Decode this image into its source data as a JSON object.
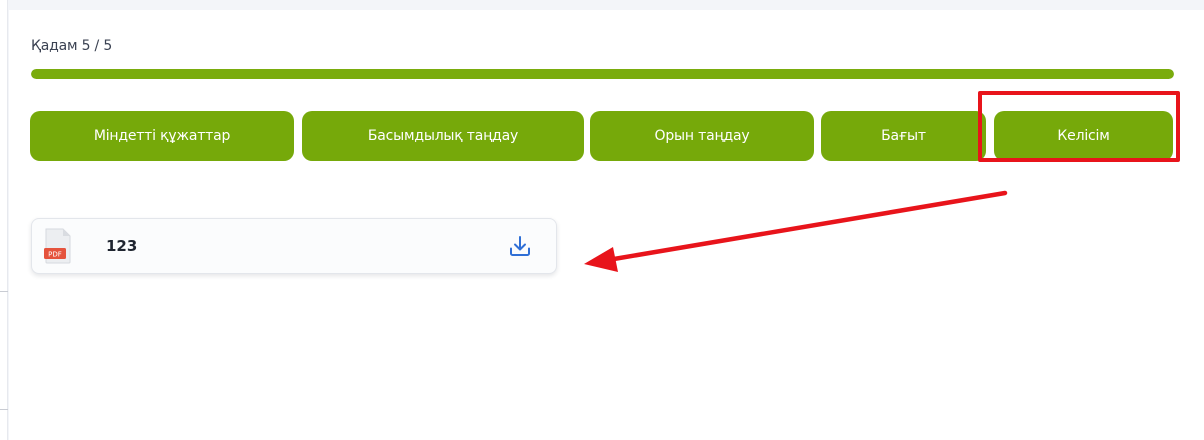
{
  "step": {
    "label": "Қадам 5 / 5",
    "progress_fraction": 1.0
  },
  "tabs": [
    {
      "label": "Міндетті құжаттар"
    },
    {
      "label": "Басымдылық таңдау"
    },
    {
      "label": "Орын таңдау"
    },
    {
      "label": "Бағыт"
    },
    {
      "label": "Келісім"
    }
  ],
  "file": {
    "name": "123",
    "icon": "pdf-file-icon",
    "badge": "PDF",
    "action_icon": "download-icon"
  },
  "colors": {
    "accent": "#76a90a",
    "annotation": "#e8141b",
    "download": "#2f6fd6",
    "pdf": "#e5533d"
  }
}
